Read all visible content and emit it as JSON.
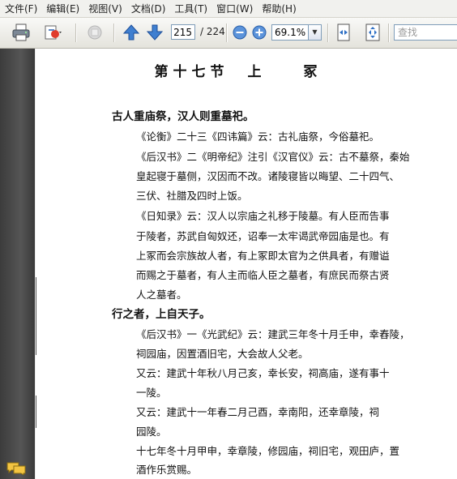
{
  "menu": {
    "items": [
      "文件(F)",
      "编辑(E)",
      "视图(V)",
      "文档(D)",
      "工具(T)",
      "窗口(W)",
      "帮助(H)"
    ]
  },
  "toolbar": {
    "current_page": "215",
    "total_pages": "/ 224",
    "zoom": "69.1%",
    "search_placeholder": "查找"
  },
  "document": {
    "title": "第十七节　上　　冢",
    "lines": [
      "古人重庙祭，汉人则重墓祀。",
      "《论衡》二十三《四讳篇》云：古礼庙祭，今俗墓祀。",
      "《后汉书》二《明帝纪》注引《汉官仪》云：古不墓祭，秦始",
      "皇起寝于墓侧，汉因而不改。诸陵寝皆以晦望、二十四气、",
      "三伏、社腊及四时上饭。",
      "《日知录》云：汉人以宗庙之礼移于陵墓。有人臣而告事",
      "于陵者，苏武自匈奴还，诏奉一太牢谒武帝园庙是也。有",
      "上冢而会宗族故人者，有上冢即太官为之供具者，有赠谥",
      "而赐之于墓者，有人主而临人臣之墓者，有庶民而祭古贤",
      "人之墓者。",
      "行之者，上自天子。",
      "《后汉书》一《光武纪》云：建武三年冬十月壬申，幸舂陵，",
      "祠园庙，因置酒旧宅，大会故人父老。",
      "又云：建武十年秋八月己亥，幸长安，祠高庙，遂有事十",
      "一陵。",
      "又云：建武十一年春二月己酉，幸南阳，还幸章陵，祠",
      "园陵。",
      "十七年冬十月甲申，幸章陵，修园庙，祠旧宅，观田庐，置",
      "酒作乐赏赐。"
    ]
  },
  "icons": {
    "print": "printer-icon",
    "attach": "attachment-icon",
    "prev": "arrow-up-icon",
    "next": "arrow-down-icon",
    "zoom_out": "zoom-out-icon",
    "zoom_in": "zoom-in-icon",
    "fit_width": "fit-width-icon",
    "fit_page": "fit-page-icon",
    "comments": "comments-icon"
  }
}
